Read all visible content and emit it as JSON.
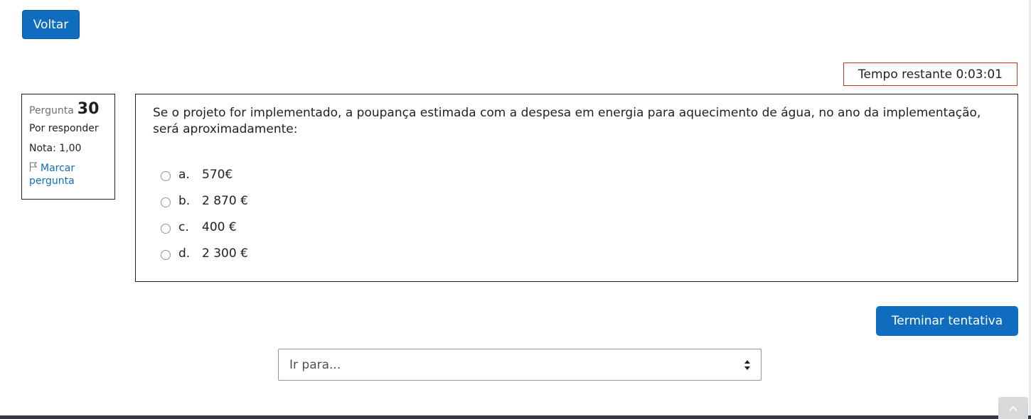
{
  "nav": {
    "back_label": "Voltar"
  },
  "timer": {
    "text": "Tempo restante 0:03:01"
  },
  "question_info": {
    "label": "Pergunta",
    "number": "30",
    "state": "Por responder",
    "grade": "Nota: 1,00",
    "flag_label": "Marcar pergunta"
  },
  "question": {
    "text": "Se o projeto for implementado, a poupança estimada com a despesa em energia para aquecimento de água, no ano da implementação, será aproximadamente:",
    "answers": [
      {
        "letter": "a.",
        "text": "570€"
      },
      {
        "letter": "b.",
        "text": "2 870 €"
      },
      {
        "letter": "c.",
        "text": "400 €"
      },
      {
        "letter": "d.",
        "text": "2 300 €"
      }
    ]
  },
  "actions": {
    "finish_label": "Terminar tentativa",
    "goto_selected": "Ir para..."
  },
  "colors": {
    "primary": "#0f6cbf",
    "timer_border": "#ca3120",
    "footer": "#343a40"
  }
}
